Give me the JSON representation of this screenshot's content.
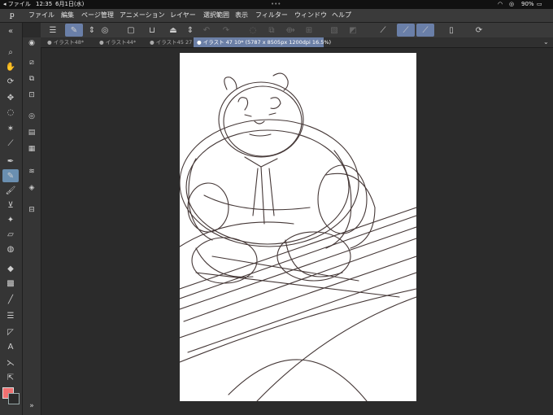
{
  "status": {
    "app_back": "◂ ファイル",
    "time": "12:35",
    "date": "6月1日(水)",
    "battery": "90%",
    "dots": "•••"
  },
  "menu": {
    "items": [
      "ファイル",
      "編集",
      "ページ管理",
      "アニメーション",
      "レイヤー",
      "選択範囲",
      "表示",
      "フィルター",
      "ウィンドウ",
      "ヘルプ"
    ]
  },
  "tabs": [
    {
      "label": "● イラスト48*"
    },
    {
      "label": "● イラスト44*"
    },
    {
      "label": "● イラスト45 27"
    },
    {
      "label": "● イラスト 47 10* (5787 x 8505px 1200dpi 16.5%)"
    }
  ],
  "toolbar": {
    "menu_icon": "hamburger-icon"
  },
  "colors": {
    "foreground": "#f07070",
    "background": "#2a2a2a",
    "accent": "#6b7fa6",
    "sketch_stroke": "#3b2d2c"
  }
}
